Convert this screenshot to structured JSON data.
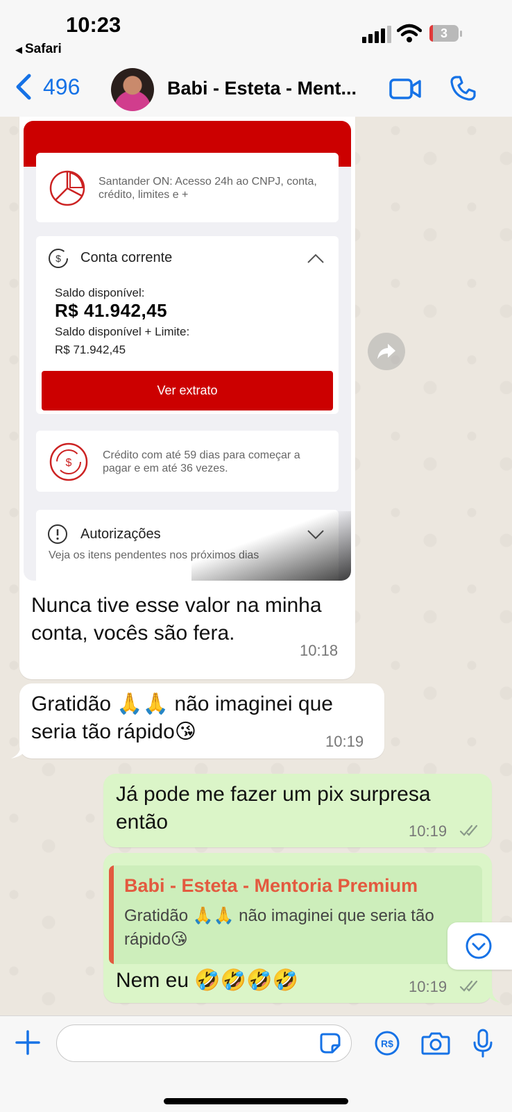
{
  "status_bar": {
    "time": "10:23",
    "back_app": "Safari",
    "battery_level": "3"
  },
  "header": {
    "back_count": "496",
    "contact_name": "Babi - Esteta - Ment...",
    "accent_color": "#1672e6"
  },
  "image_message": {
    "bank_info": "Santander ON: Acesso 24h ao CNPJ, conta, crédito, limites e +",
    "account_title": "Conta corrente",
    "balance_label": "Saldo disponível:",
    "balance_value": "R$ 41.942,45",
    "limit_label": "Saldo disponível + Limite:",
    "limit_value": "R$ 71.942,45",
    "statement_button": "Ver extrato",
    "credit_info": "Crédito com até 59 dias para começar a pagar e em até 36 vezes.",
    "authorizations_title": "Autorizações",
    "authorizations_sub": "Veja os itens pendentes nos próximos dias",
    "brand_color": "#cc0000"
  },
  "messages": [
    {
      "text": "Nunca tive esse valor na minha conta, vocês são fera.",
      "time": "10:18",
      "direction": "in"
    },
    {
      "text": "Gratidão 🙏🙏 não imaginei que seria tão rápido😘",
      "time": "10:19",
      "direction": "in"
    },
    {
      "text": "Já pode me fazer um pix surpresa então",
      "time": "10:19",
      "direction": "out",
      "status": "read"
    },
    {
      "quote_name": "Babi - Esteta - Mentoria Premium",
      "quote_text": "Gratidão 🙏🙏 não imaginei que seria tão rápido😘",
      "text": "Nem eu 🤣🤣🤣🤣",
      "time": "10:19",
      "direction": "out",
      "status": "read"
    }
  ],
  "composer": {
    "placeholder": ""
  }
}
